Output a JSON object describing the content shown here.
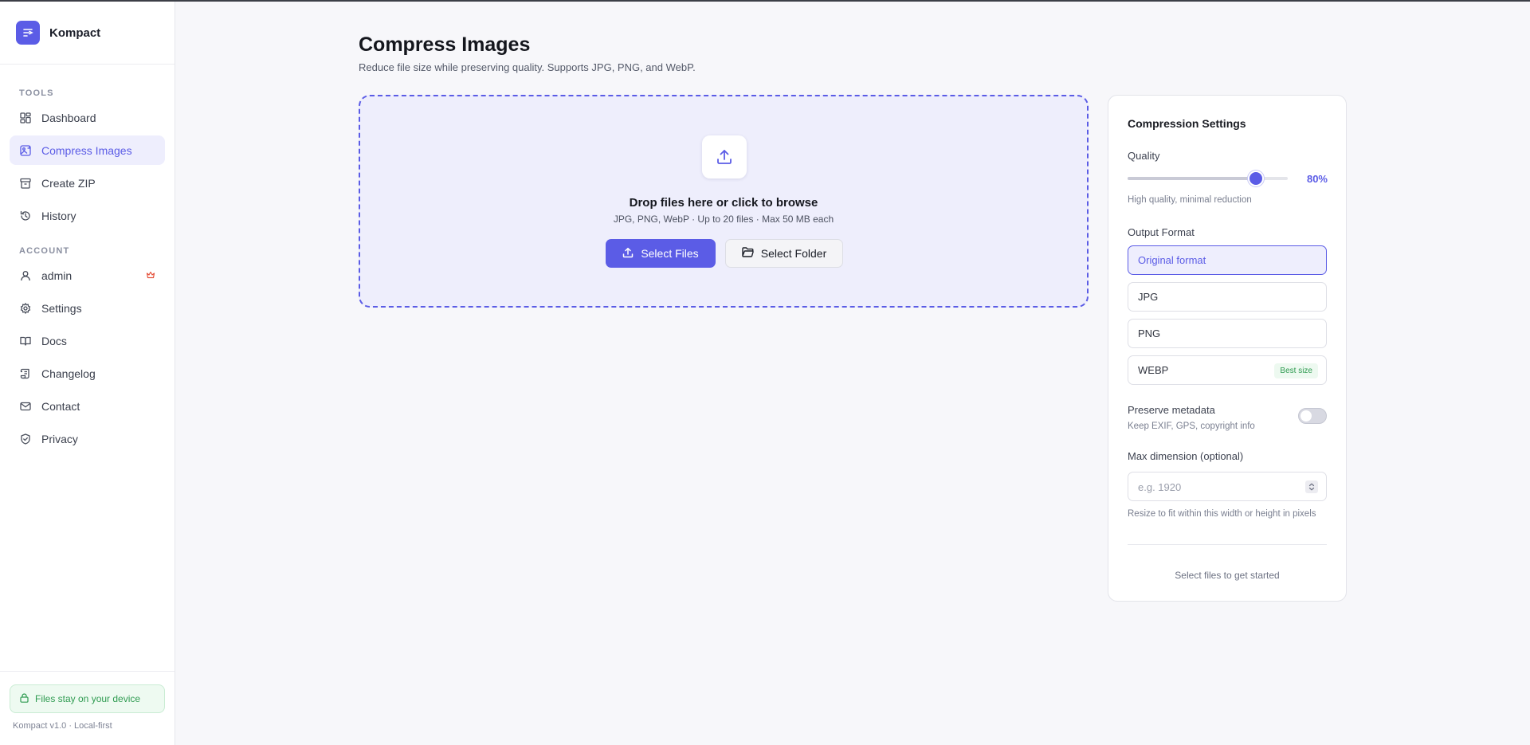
{
  "app": {
    "name": "Kompact",
    "version_text": "Kompact v1.0 · Local-first",
    "device_note": "Files stay on your device"
  },
  "colors": {
    "accent": "#5b5ce6",
    "accent_soft": "#eeeefd",
    "success": "#2f9b51",
    "crown": "#e5533d"
  },
  "sidebar": {
    "tools_label": "TOOLS",
    "account_label": "ACCOUNT",
    "tools": [
      {
        "label": "Dashboard",
        "icon": "dashboard-icon"
      },
      {
        "label": "Compress Images",
        "icon": "image-icon",
        "active": true
      },
      {
        "label": "Create ZIP",
        "icon": "archive-icon"
      },
      {
        "label": "History",
        "icon": "history-icon"
      }
    ],
    "account": [
      {
        "label": "admin",
        "icon": "user-icon",
        "badge_icon": "crown-icon"
      },
      {
        "label": "Settings",
        "icon": "gear-icon"
      },
      {
        "label": "Docs",
        "icon": "book-icon"
      },
      {
        "label": "Changelog",
        "icon": "scroll-icon"
      },
      {
        "label": "Contact",
        "icon": "mail-icon"
      },
      {
        "label": "Privacy",
        "icon": "shield-icon"
      }
    ]
  },
  "page": {
    "title": "Compress Images",
    "subtitle": "Reduce file size while preserving quality. Supports JPG, PNG, and WebP."
  },
  "dropzone": {
    "title": "Drop files here or click to browse",
    "hint": "JPG, PNG, WebP · Up to 20 files · Max 50 MB each",
    "select_files_label": "Select Files",
    "select_folder_label": "Select Folder"
  },
  "settings": {
    "title": "Compression Settings",
    "quality_label": "Quality",
    "quality_percent": 80,
    "quality_value_text": "80%",
    "quality_hint": "High quality, minimal reduction",
    "output_format_label": "Output Format",
    "formats": [
      {
        "label": "Original format",
        "selected": true
      },
      {
        "label": "JPG"
      },
      {
        "label": "PNG"
      },
      {
        "label": "WEBP",
        "badge": "Best size"
      }
    ],
    "preserve_metadata_label": "Preserve metadata",
    "preserve_metadata_hint": "Keep EXIF, GPS, copyright info",
    "preserve_metadata_on": false,
    "max_dimension_label": "Max dimension (optional)",
    "max_dimension_placeholder": "e.g. 1920",
    "max_dimension_value": "",
    "max_dimension_hint": "Resize to fit within this width or height in pixels",
    "cta_hint": "Select files to get started"
  }
}
